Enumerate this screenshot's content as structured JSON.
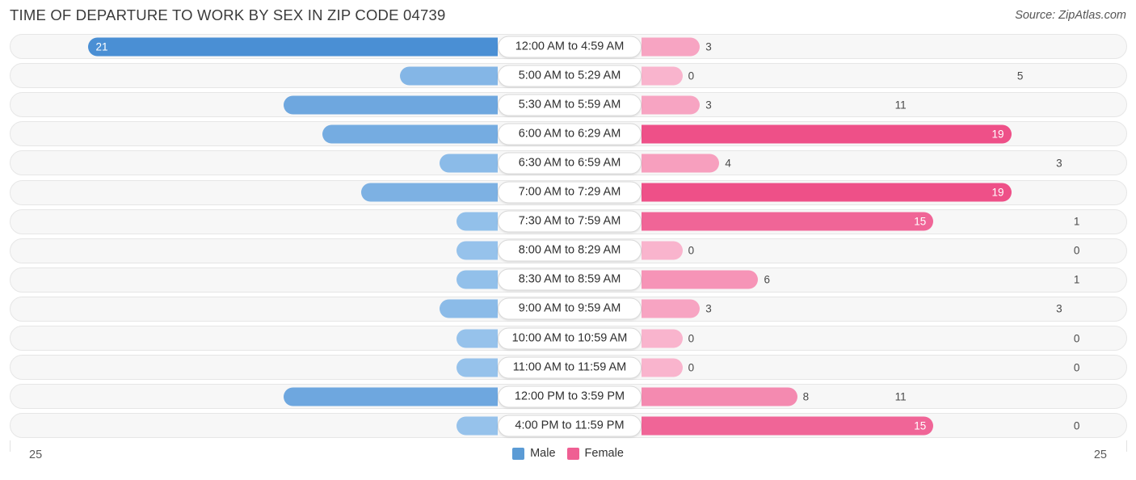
{
  "header": {
    "title": "TIME OF DEPARTURE TO WORK BY SEX IN ZIP CODE 04739",
    "source": "Source: ZipAtlas.com"
  },
  "legend": {
    "male_label": "Male",
    "female_label": "Female",
    "male_color": "#5b9bd5",
    "female_color": "#ef5f93"
  },
  "axis": {
    "left_value": "25",
    "right_value": "25"
  },
  "chart_data": {
    "type": "bar",
    "orientation": "horizontal-diverging",
    "title": "TIME OF DEPARTURE TO WORK BY SEX IN ZIP CODE 04739",
    "xlabel": "",
    "ylabel": "",
    "xlim": [
      25,
      25
    ],
    "grid": false,
    "legend_position": "bottom-center",
    "categories": [
      "12:00 AM to 4:59 AM",
      "5:00 AM to 5:29 AM",
      "5:30 AM to 5:59 AM",
      "6:00 AM to 6:29 AM",
      "6:30 AM to 6:59 AM",
      "7:00 AM to 7:29 AM",
      "7:30 AM to 7:59 AM",
      "8:00 AM to 8:29 AM",
      "8:30 AM to 8:59 AM",
      "9:00 AM to 9:59 AM",
      "10:00 AM to 10:59 AM",
      "11:00 AM to 11:59 AM",
      "12:00 PM to 3:59 PM",
      "4:00 PM to 11:59 PM"
    ],
    "series": [
      {
        "name": "Male",
        "values": [
          21,
          5,
          11,
          9,
          3,
          7,
          1,
          0,
          1,
          3,
          0,
          0,
          11,
          0
        ]
      },
      {
        "name": "Female",
        "values": [
          3,
          0,
          3,
          19,
          4,
          19,
          15,
          0,
          6,
          3,
          0,
          0,
          8,
          15
        ]
      }
    ]
  }
}
